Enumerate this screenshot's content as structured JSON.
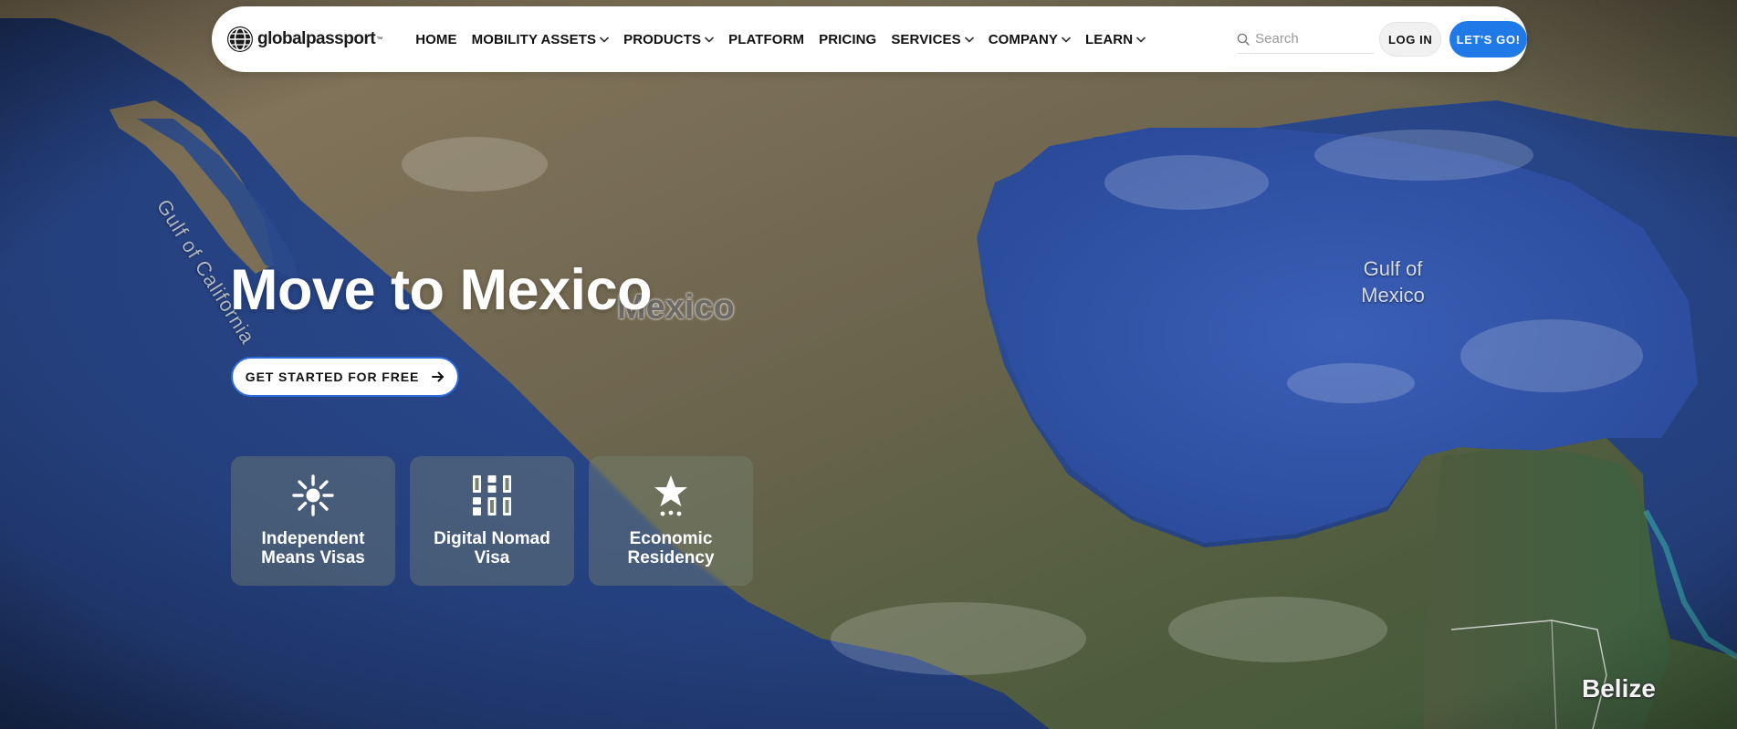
{
  "brand": {
    "name": "globalpassport",
    "trademark": "™"
  },
  "nav": {
    "items": [
      {
        "label": "HOME",
        "has_dropdown": false
      },
      {
        "label": "MOBILITY ASSETS",
        "has_dropdown": true
      },
      {
        "label": "PRODUCTS",
        "has_dropdown": true
      },
      {
        "label": "PLATFORM",
        "has_dropdown": false
      },
      {
        "label": "PRICING",
        "has_dropdown": false
      },
      {
        "label": "SERVICES",
        "has_dropdown": true
      },
      {
        "label": "COMPANY",
        "has_dropdown": true
      },
      {
        "label": "LEARN",
        "has_dropdown": true
      }
    ],
    "search": {
      "placeholder": "Search",
      "value": "",
      "icon": "search-icon"
    },
    "login_label": "LOG IN",
    "cta_label": "LET'S GO!"
  },
  "hero": {
    "title": "Move to Mexico",
    "cta_label": "GET STARTED FOR FREE",
    "cta_icon": "arrow-right-icon",
    "cards": [
      {
        "label": "Independent\nMeans Visas",
        "icon": "sun-burst-icon"
      },
      {
        "label": "Digital Nomad\nVisa",
        "icon": "grid-blocks-icon"
      },
      {
        "label": "Economic\nResidency",
        "icon": "star-icon"
      }
    ]
  },
  "map_labels": {
    "gulf_of_california": "Gulf of California",
    "mexico": "Mexico",
    "gulf_of_mexico": "Gulf of Mexico",
    "belize": "Belize"
  },
  "colors": {
    "accent": "#1f7ae8",
    "ocean": "#2a4a8c",
    "land": "#6d6550",
    "navbar_bg": "#ffffff"
  }
}
